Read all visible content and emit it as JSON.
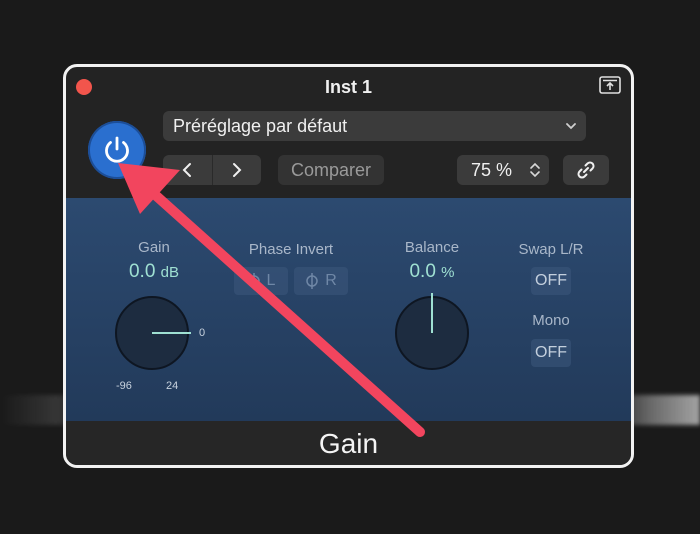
{
  "window": {
    "title": "Inst 1",
    "footer_label": "Gain"
  },
  "header": {
    "preset": "Préréglage par défaut",
    "compare_label": "Comparer",
    "zoom": "75 %"
  },
  "controls": {
    "gain": {
      "label": "Gain",
      "value": "0.0",
      "unit": "dB",
      "scale_min": "-96",
      "scale_max": "24",
      "tick_label": "0"
    },
    "phase_invert": {
      "label": "Phase Invert",
      "left": "L",
      "right": "R"
    },
    "balance": {
      "label": "Balance",
      "value": "0.0",
      "unit": "%"
    },
    "swap": {
      "label": "Swap L/R",
      "state": "OFF"
    },
    "mono": {
      "label": "Mono",
      "state": "OFF"
    }
  },
  "colors": {
    "power": "#2a6fcf",
    "accent_value": "#9fe0d2",
    "annotation_arrow": "#f2455e",
    "close": "#f2554c"
  },
  "icons": [
    "close-icon",
    "upload-icon",
    "power-icon",
    "chevron-down-icon",
    "chevron-left-icon",
    "chevron-right-icon",
    "stepper-icon",
    "link-icon",
    "phase-icon"
  ]
}
